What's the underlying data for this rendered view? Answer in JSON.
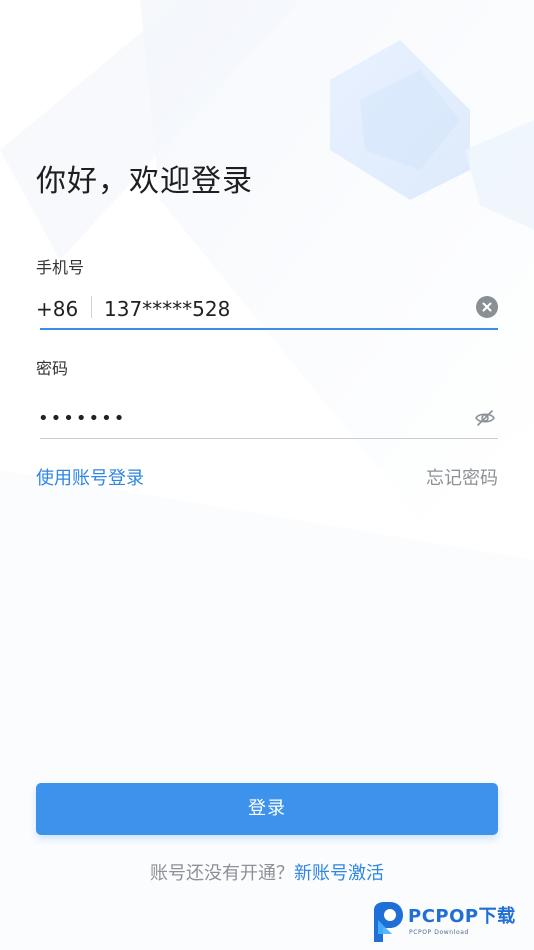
{
  "login": {
    "title": "你好，欢迎登录",
    "phone_label": "手机号",
    "country_code": "+86",
    "phone_value": "137*****528",
    "password_label": "密码",
    "password_value": "1234567",
    "account_login_link": "使用账号登录",
    "forgot_password_link": "忘记密码",
    "login_button": "登录",
    "signup_question": "账号还没有开通？",
    "signup_link": "新账号激活"
  },
  "watermark": {
    "brand": "PCPOP下载",
    "subtitle": "PCPOP Download"
  },
  "icons": {
    "clear": "clear-icon",
    "password_visibility": "eye-off-icon",
    "watermark_logo": "pcpop-logo-icon"
  },
  "colors": {
    "accent": "#3d92ec",
    "link": "#2f86e4",
    "muted_text": "#8c9196",
    "input_underline_active": "#3a8ee8",
    "input_underline": "#c9ced3"
  }
}
